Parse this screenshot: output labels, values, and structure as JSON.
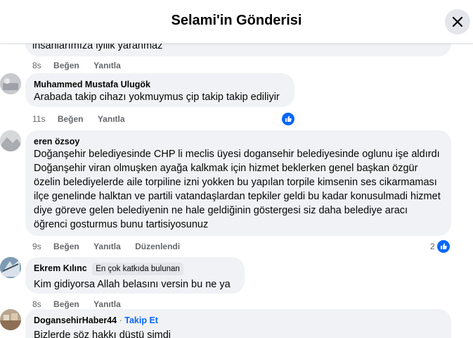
{
  "header": {
    "title": "Selami'in Gönderisi"
  },
  "comments": [
    {
      "author": "",
      "text": "insanlarımıza iyilik yaranmaz",
      "time": "8s",
      "like_label": "Beğen",
      "reply_label": "Yanıtla"
    },
    {
      "author": "Muhammed Mustafa Ulugök",
      "text": "Arabada takip cihazı yokmuymus çip takip takip ediliyir",
      "time": "11s",
      "like_label": "Beğen",
      "reply_label": "Yanıtla",
      "reaction_icon": "like-icon"
    },
    {
      "author": "eren özsoy",
      "text": "Doğanşehir belediyesinde CHP li meclis üyesi dogansehir belediyesinde oglunu işe aldırdı Doğanşehir viran olmuşken ayağa kalkmak için hizmet beklerken genel başkan özgür özelin belediyelerde aile torpiline izni yokken bu yapılan torpile kimsenin ses cikarmaması ilçe genelinde halktan ve partili vatandaşlardan tepkiler geldi bu kadar konusulmadi hizmet diye göreve gelen belediyenin ne hale geldiğinin göstergesi siz daha belediye aracı öğrenci gosturmus bunu tartisiyosunuz",
      "time": "9s",
      "like_label": "Beğen",
      "reply_label": "Yanıtla",
      "edited_label": "Düzenlendi",
      "reaction_count": "2",
      "reaction_icon": "like-icon"
    },
    {
      "author": "Ekrem Kılınc",
      "badge": "En çok katkıda bulunan",
      "text": "Kim gidiyorsa Allah belasını versin bu ne ya",
      "time": "8s",
      "like_label": "Beğen",
      "reply_label": "Yanıtla"
    },
    {
      "author": "DogansehirHaber44",
      "separator": "·",
      "follow_label": "Takip Et",
      "text": "Bizlerde söz hakkı düştü şimdi"
    }
  ],
  "colors": {
    "accent": "#0866ff",
    "bubble": "#f0f2f5",
    "meta": "#65676b"
  }
}
